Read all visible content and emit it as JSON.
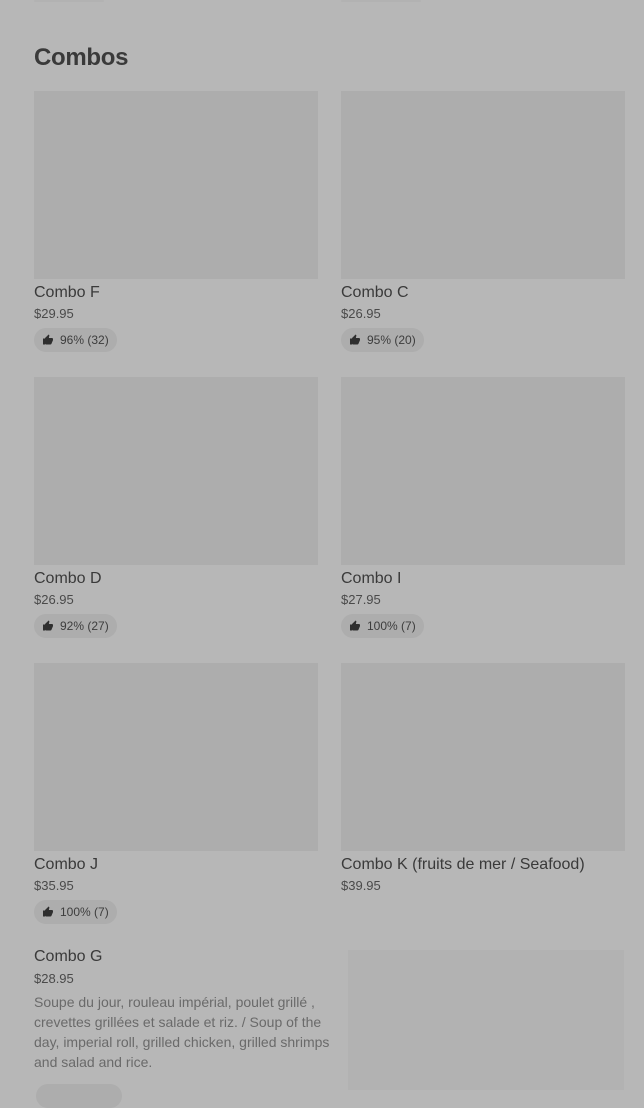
{
  "section": {
    "title": "Combos"
  },
  "items": [
    {
      "name": "Combo F",
      "price": "$29.95",
      "rating": "96% (32)"
    },
    {
      "name": "Combo C",
      "price": "$26.95",
      "rating": "95% (20)"
    },
    {
      "name": "Combo D",
      "price": "$26.95",
      "rating": "92% (27)"
    },
    {
      "name": "Combo I",
      "price": "$27.95",
      "rating": "100% (7)"
    },
    {
      "name": "Combo J",
      "price": "$35.95",
      "rating": "100% (7)"
    },
    {
      "name": "Combo K (fruits de mer / Seafood)",
      "price": "$39.95",
      "rating": null
    }
  ],
  "featured": {
    "name": "Combo G",
    "price": "$28.95",
    "description": "Soupe du jour, rouleau impérial, poulet grillé , crevettes grillées et salade et riz. / Soup of the day, imperial roll, grilled chicken, grilled shrimps and salad and rice."
  },
  "icons": {
    "rating": "thumbs-up-icon"
  },
  "colors": {
    "overlay": "#b7b7b7",
    "placeholder": "#adadad",
    "text": "#3a3a3a"
  }
}
